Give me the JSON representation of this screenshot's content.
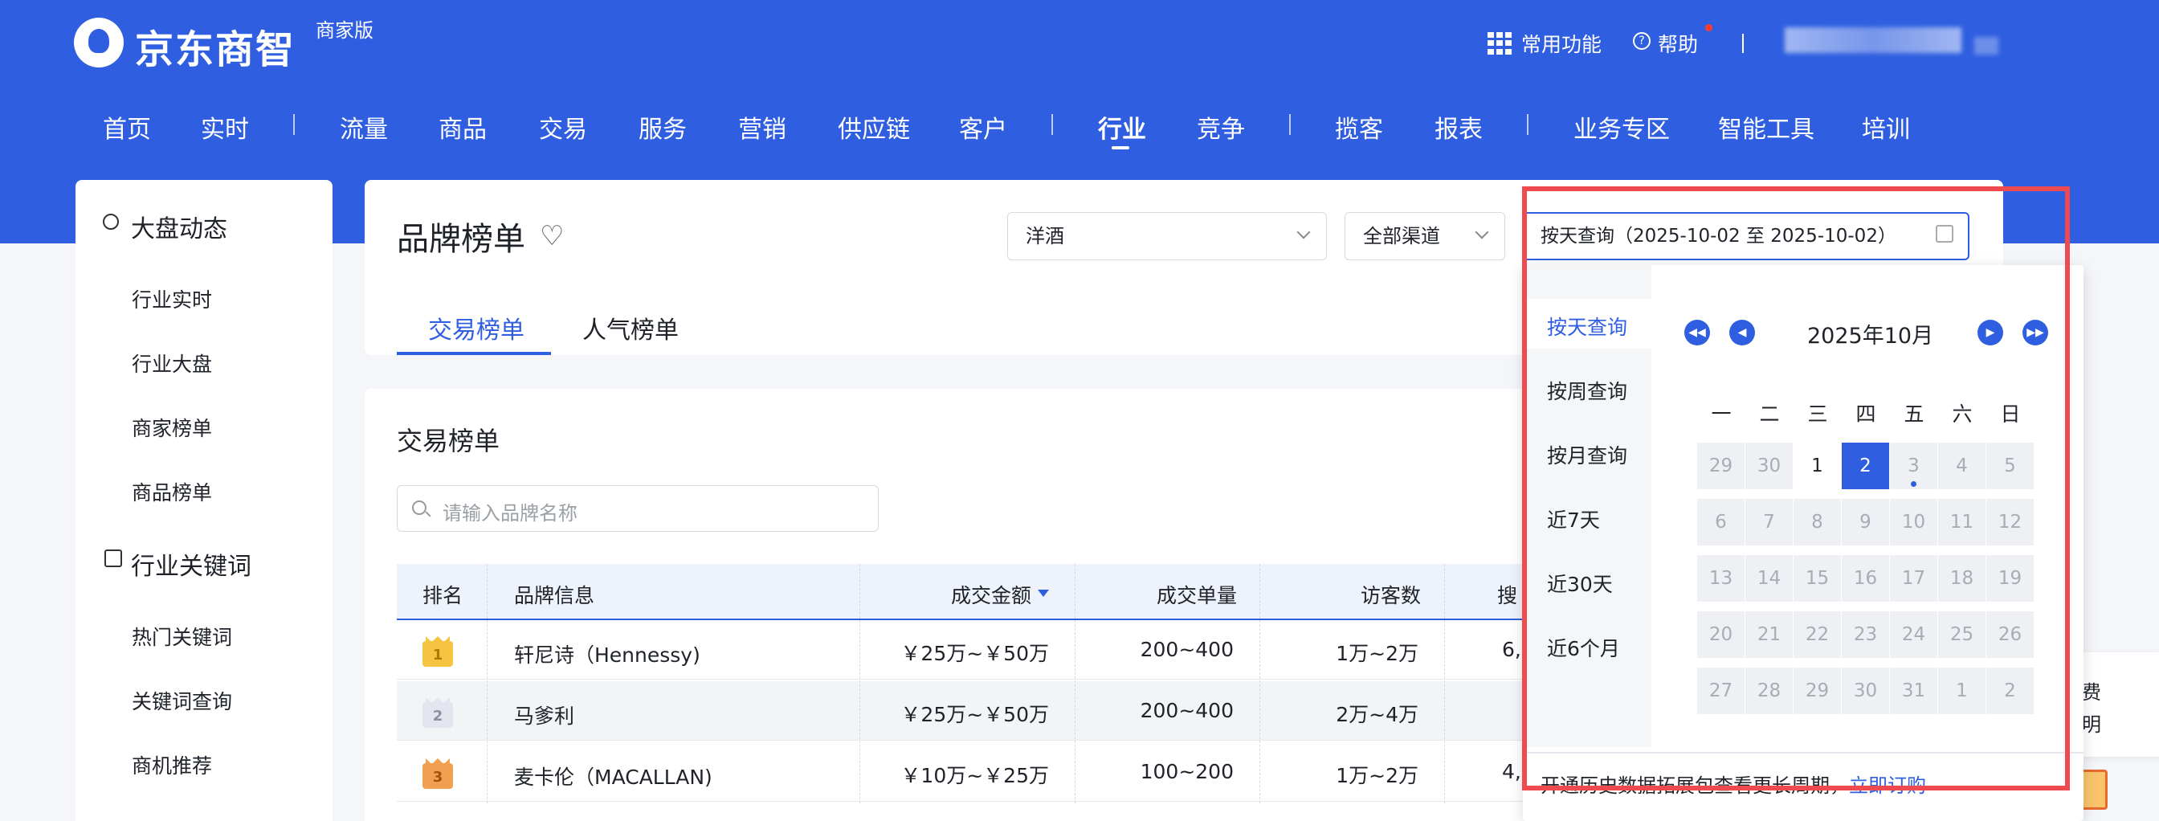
{
  "header": {
    "logo_text": "京东商智",
    "edition": "商家版",
    "common_functions": "常用功能",
    "help": "帮助",
    "nav": [
      "首页",
      "实时",
      "流量",
      "商品",
      "交易",
      "服务",
      "营销",
      "供应链",
      "客户",
      "行业",
      "竞争",
      "揽客",
      "报表",
      "业务专区",
      "智能工具",
      "培训"
    ],
    "active_nav": "行业"
  },
  "sidebar": {
    "group1_title": "大盘动态",
    "group1_items": [
      "行业实时",
      "行业大盘",
      "商家榜单",
      "商品榜单"
    ],
    "group2_title": "行业关键词",
    "group2_items": [
      "热门关键词",
      "关键词查询",
      "商机推荐"
    ]
  },
  "page": {
    "title": "品牌榜单",
    "category_select": "洋酒",
    "channel_select": "全部渠道",
    "date_input": "按天查询（2025-10-02 至 2025-10-02）",
    "tabs": [
      "交易榜单",
      "人气榜单"
    ]
  },
  "table": {
    "section_title": "交易榜单",
    "search_placeholder": "请输入品牌名称",
    "headers": [
      "排名",
      "品牌信息",
      "成交金额",
      "成交单量",
      "访客数",
      "搜"
    ],
    "rows": [
      {
        "rank": "1",
        "brand": "轩尼诗（Hennessy)",
        "amount": "￥25万~￥50万",
        "orders": "200~400",
        "visitors": "1万~2万",
        "search": "6,"
      },
      {
        "rank": "2",
        "brand": "马爹利",
        "amount": "￥25万~￥50万",
        "orders": "200~400",
        "visitors": "2万~4万",
        "search": ""
      },
      {
        "rank": "3",
        "brand": "麦卡伦（MACALLAN)",
        "amount": "￥10万~￥25万",
        "orders": "100~200",
        "visitors": "1万~2万",
        "search": "4,"
      }
    ]
  },
  "date_picker": {
    "options": [
      "按天查询",
      "按周查询",
      "按月查询",
      "近7天",
      "近30天",
      "近6个月"
    ],
    "active_option": "按天查询",
    "month_label": "2025年10月",
    "weekdays": [
      "一",
      "二",
      "三",
      "四",
      "五",
      "六",
      "日"
    ],
    "weeks": [
      [
        "29",
        "30",
        "1",
        "2",
        "3",
        "4",
        "5"
      ],
      [
        "6",
        "7",
        "8",
        "9",
        "10",
        "11",
        "12"
      ],
      [
        "13",
        "14",
        "15",
        "16",
        "17",
        "18",
        "19"
      ],
      [
        "20",
        "21",
        "22",
        "23",
        "24",
        "25",
        "26"
      ],
      [
        "27",
        "28",
        "29",
        "30",
        "31",
        "1",
        "2"
      ]
    ],
    "selected_day": "2",
    "footer_text": "开通历史数据拓展包查看更长周期，",
    "footer_link": "立即订购"
  },
  "side_float": {
    "line1": "费",
    "line2": "明"
  },
  "colors": {
    "brand_blue": "#2f5fe0",
    "highlight_red": "#ef4a4f"
  }
}
